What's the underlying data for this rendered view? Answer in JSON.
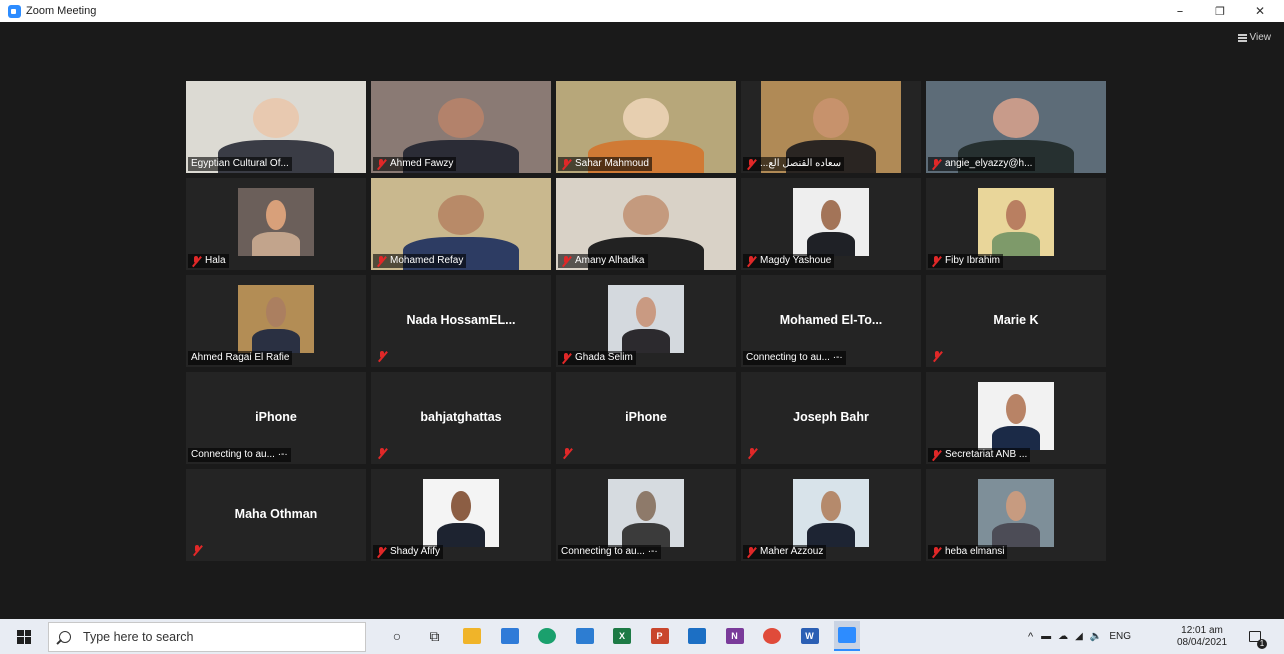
{
  "window": {
    "title": "Zoom Meeting",
    "minimize_glyph": "–",
    "restore_glyph": "❐",
    "close_glyph": "✕"
  },
  "view_button": {
    "label": "View",
    "icon": "grid-icon"
  },
  "participants": [
    {
      "id": "p1",
      "label": "Egyptian Cultural Of...",
      "muted": false,
      "video": true,
      "active": false,
      "colors": [
        "#dcdad3",
        "#3a3c45",
        "#e8c9b0"
      ]
    },
    {
      "id": "p2",
      "label": "Ahmed Fawzy",
      "muted": true,
      "video": true,
      "active": true,
      "colors": [
        "#8a7a74",
        "#2b2c36",
        "#b3826b"
      ]
    },
    {
      "id": "p3",
      "label": "Sahar Mahmoud",
      "muted": true,
      "video": true,
      "active": false,
      "colors": [
        "#b7a77a",
        "#d07a35",
        "#e7cfb0"
      ]
    },
    {
      "id": "p4",
      "label": "سعاده القنصل الع...",
      "muted": true,
      "video": true,
      "active": false,
      "rtl": true,
      "colors": [
        "#b08a56",
        "#2a2522",
        "#c7926c"
      ]
    },
    {
      "id": "p5",
      "label": "angie_elyazzy@h...",
      "muted": true,
      "video": true,
      "active": false,
      "colors": [
        "#5d6c78",
        "#263030",
        "#c89b8a"
      ]
    },
    {
      "id": "p6",
      "label": "Hala",
      "muted": true,
      "video": true,
      "active": false,
      "colors": [
        "#6b5f5a",
        "#c2a48c",
        "#d8a07a"
      ]
    },
    {
      "id": "p7",
      "label": "Mohamed Refay",
      "muted": true,
      "video": true,
      "active": false,
      "colors": [
        "#c9b88e",
        "#2d3c63",
        "#b88a68"
      ]
    },
    {
      "id": "p8",
      "label": "Amany Alhadka",
      "muted": true,
      "video": true,
      "active": false,
      "colors": [
        "#d9d2c7",
        "#222222",
        "#c49a7e"
      ]
    },
    {
      "id": "p9",
      "label": "Magdy Yashoue",
      "muted": true,
      "video": true,
      "active": false,
      "colors": [
        "#eeeeee",
        "#1f2126",
        "#a37458"
      ]
    },
    {
      "id": "p10",
      "label": "Fiby Ibrahim",
      "muted": true,
      "video": true,
      "active": false,
      "colors": [
        "#e9d69a",
        "#7e9a6a",
        "#b97f61"
      ]
    },
    {
      "id": "p11",
      "label": "Ahmed Ragai El Rafie",
      "muted": false,
      "video": true,
      "active": false,
      "colors": [
        "#b38d55",
        "#2a3042",
        "#ab7f60"
      ]
    },
    {
      "id": "p12",
      "name": "Nada  HossamEL...",
      "label": "",
      "muted": true,
      "video": false
    },
    {
      "id": "p13",
      "label": "Ghada Selim",
      "muted": true,
      "video": true,
      "active": false,
      "colors": [
        "#d4d9de",
        "#2c2a2e",
        "#c99a82"
      ]
    },
    {
      "id": "p14",
      "name": "Mohamed  El-To...",
      "label": "Connecting to au... ·-·",
      "muted": false,
      "video": false
    },
    {
      "id": "p15",
      "name": "Marie K",
      "label": "",
      "muted": true,
      "video": false
    },
    {
      "id": "p16",
      "name": "iPhone",
      "label": "Connecting to au... ·-·",
      "muted": false,
      "video": false
    },
    {
      "id": "p17",
      "name": "bahjatghattas",
      "label": "",
      "muted": true,
      "video": false
    },
    {
      "id": "p18",
      "name": "iPhone",
      "label": "",
      "muted": true,
      "video": false
    },
    {
      "id": "p19",
      "name": "Joseph Bahr",
      "label": "",
      "muted": true,
      "video": false
    },
    {
      "id": "p20",
      "label": "Secretariat ANB ...",
      "muted": true,
      "video": true,
      "active": false,
      "colors": [
        "#f2f2f2",
        "#1b2a47",
        "#b88366"
      ]
    },
    {
      "id": "p21",
      "name": "Maha Othman",
      "label": "",
      "muted": true,
      "video": false
    },
    {
      "id": "p22",
      "label": "Shady Afify",
      "muted": true,
      "video": true,
      "active": false,
      "colors": [
        "#f4f4f4",
        "#1d2330",
        "#8c5e44"
      ]
    },
    {
      "id": "p23",
      "label": "Connecting to au... ·-·",
      "muted": false,
      "video": true,
      "active": false,
      "colors": [
        "#d6dbe0",
        "#3b3b3b",
        "#8e7a6a"
      ]
    },
    {
      "id": "p24",
      "label": "Maher Azzouz",
      "muted": true,
      "video": true,
      "active": false,
      "colors": [
        "#d8e3ea",
        "#1d2433",
        "#b58a6c"
      ]
    },
    {
      "id": "p25",
      "label": "heba elmansi",
      "muted": true,
      "video": true,
      "active": false,
      "colors": [
        "#7e8f99",
        "#4c4c56",
        "#c79b80"
      ]
    }
  ],
  "taskbar": {
    "search_placeholder": "Type here to search",
    "apps": [
      {
        "name": "cortana-icon",
        "glyph": "○",
        "color": "#1f1f1f"
      },
      {
        "name": "task-view-icon",
        "glyph": "⧉",
        "color": "#1f1f1f"
      },
      {
        "name": "file-explorer-icon",
        "glyph": "",
        "color": "#f0b429"
      },
      {
        "name": "calendar-icon",
        "glyph": "",
        "color": "#2f7bd8"
      },
      {
        "name": "edge-icon",
        "glyph": "",
        "color": "#1aa06d"
      },
      {
        "name": "store-icon",
        "glyph": "",
        "color": "#2d7dd2"
      },
      {
        "name": "excel-icon",
        "glyph": "X",
        "color": "#1d7a45"
      },
      {
        "name": "powerpoint-icon",
        "glyph": "P",
        "color": "#c9462c"
      },
      {
        "name": "mail-icon",
        "glyph": "",
        "color": "#1c6fc4"
      },
      {
        "name": "onenote-icon",
        "glyph": "N",
        "color": "#7a3b9a"
      },
      {
        "name": "chrome-icon",
        "glyph": "",
        "color": "#e04b3a"
      },
      {
        "name": "word-icon",
        "glyph": "W",
        "color": "#2b5fb4"
      },
      {
        "name": "zoom-icon",
        "glyph": "",
        "color": "#2d8cff"
      }
    ],
    "language": "ENG",
    "time": "12:01 am",
    "date": "08/04/2021",
    "notification_count": "1"
  }
}
